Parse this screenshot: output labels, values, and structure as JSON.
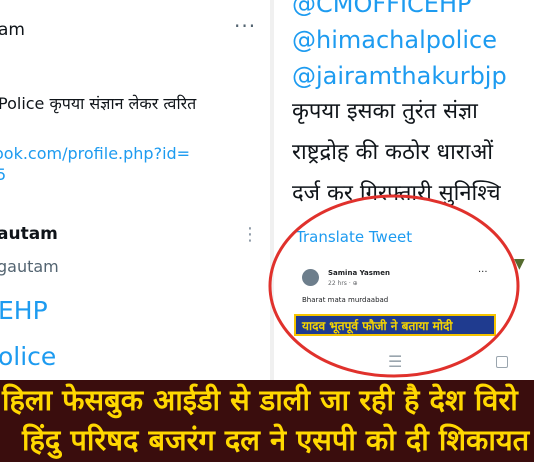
{
  "left_tweet": {
    "user_name_partial": "am",
    "more_icon": "···",
    "hindi_line": "Police कृपया संज्ञान लेकर त्वरित",
    "link_line1": "ook.com/profile.php?id=",
    "link_line2": "5",
    "reply_user_name": "autam",
    "reply_user_handle": "gautam",
    "mention_1": "EHP",
    "mention_2": "olice"
  },
  "right_tweet": {
    "mentions": [
      "@CMOFFICEHP",
      "@himachalpolice",
      "@jairamthakurbjp"
    ],
    "text_lines": [
      "कृपया इसका तुरंत संज्ञा",
      "राष्ट्रद्रोह की कठोर धाराओं",
      "दर्ज कर गिरफ्तारी सुनिश्चि"
    ],
    "translate_label": "Translate Tweet"
  },
  "fb_post": {
    "author": "Samina Yasmen",
    "time": "22 hrs · ⊕",
    "more": "···",
    "text": "Bharat mata murdaabad",
    "banner": "यादव भूतपूर्व फौजी ने बताया मोदी"
  },
  "caption": {
    "line1": "हिला फेसबुक आईडी से डाली जा रही है देश विरो",
    "line2": "हिंदु परिषद बजरंग दल ने एसपी को दी शिकायत"
  },
  "colors": {
    "link_blue": "#1d9bf0",
    "caption_bg": "#3a0d0d",
    "caption_text": "#ffd800",
    "annotation_red": "#e0312c",
    "banner_bg": "#1f3b8f"
  },
  "icons": [
    "more-horizontal-icon",
    "kebab-menu-icon",
    "avatar",
    "nav-menu-icon",
    "nav-square-icon",
    "emoji-icon"
  ]
}
